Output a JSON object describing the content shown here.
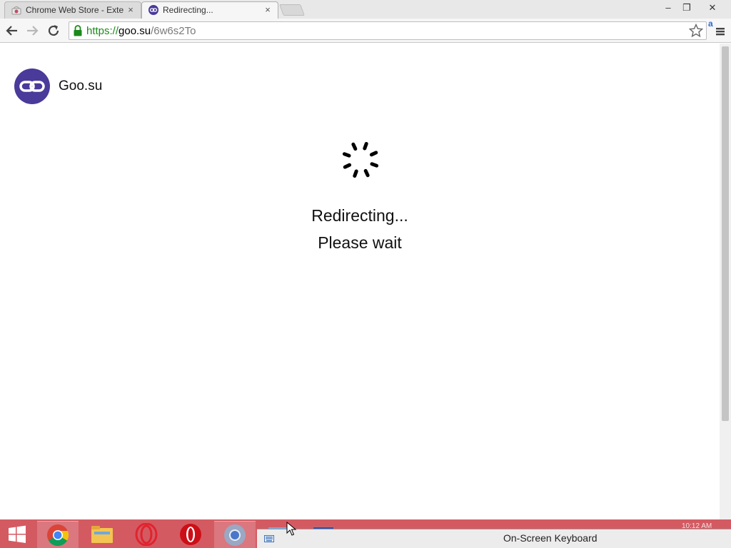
{
  "browser": {
    "tabs": [
      {
        "title": "Chrome Web Store - Exte",
        "active": false,
        "icon": "chrome-web-store-icon"
      },
      {
        "title": "Redirecting...",
        "active": true,
        "icon": "goo-su-link-icon"
      }
    ],
    "close_glyph": "×",
    "window_controls": {
      "minimize": "–",
      "restore": "❐",
      "close": "✕"
    },
    "address_bar": {
      "scheme": "https://",
      "host": "goo.su",
      "path": "/6w6s2To"
    },
    "extension_badge": "a"
  },
  "page": {
    "brand": {
      "name": "Goo.su",
      "logo_color": "#4a3a9a"
    },
    "status_line_1": "Redirecting...",
    "status_line_2": "Please wait"
  },
  "taskbar": {
    "color": "#d45a62",
    "apps": [
      "start-button",
      "chrome-icon",
      "file-explorer-icon",
      "opera-icon",
      "opera-red-icon",
      "chrome-blue-icon",
      "keyboard-app-icon",
      "window-app-icon"
    ],
    "osk_window_title": "On-Screen Keyboard",
    "clock": "10:12 AM"
  }
}
